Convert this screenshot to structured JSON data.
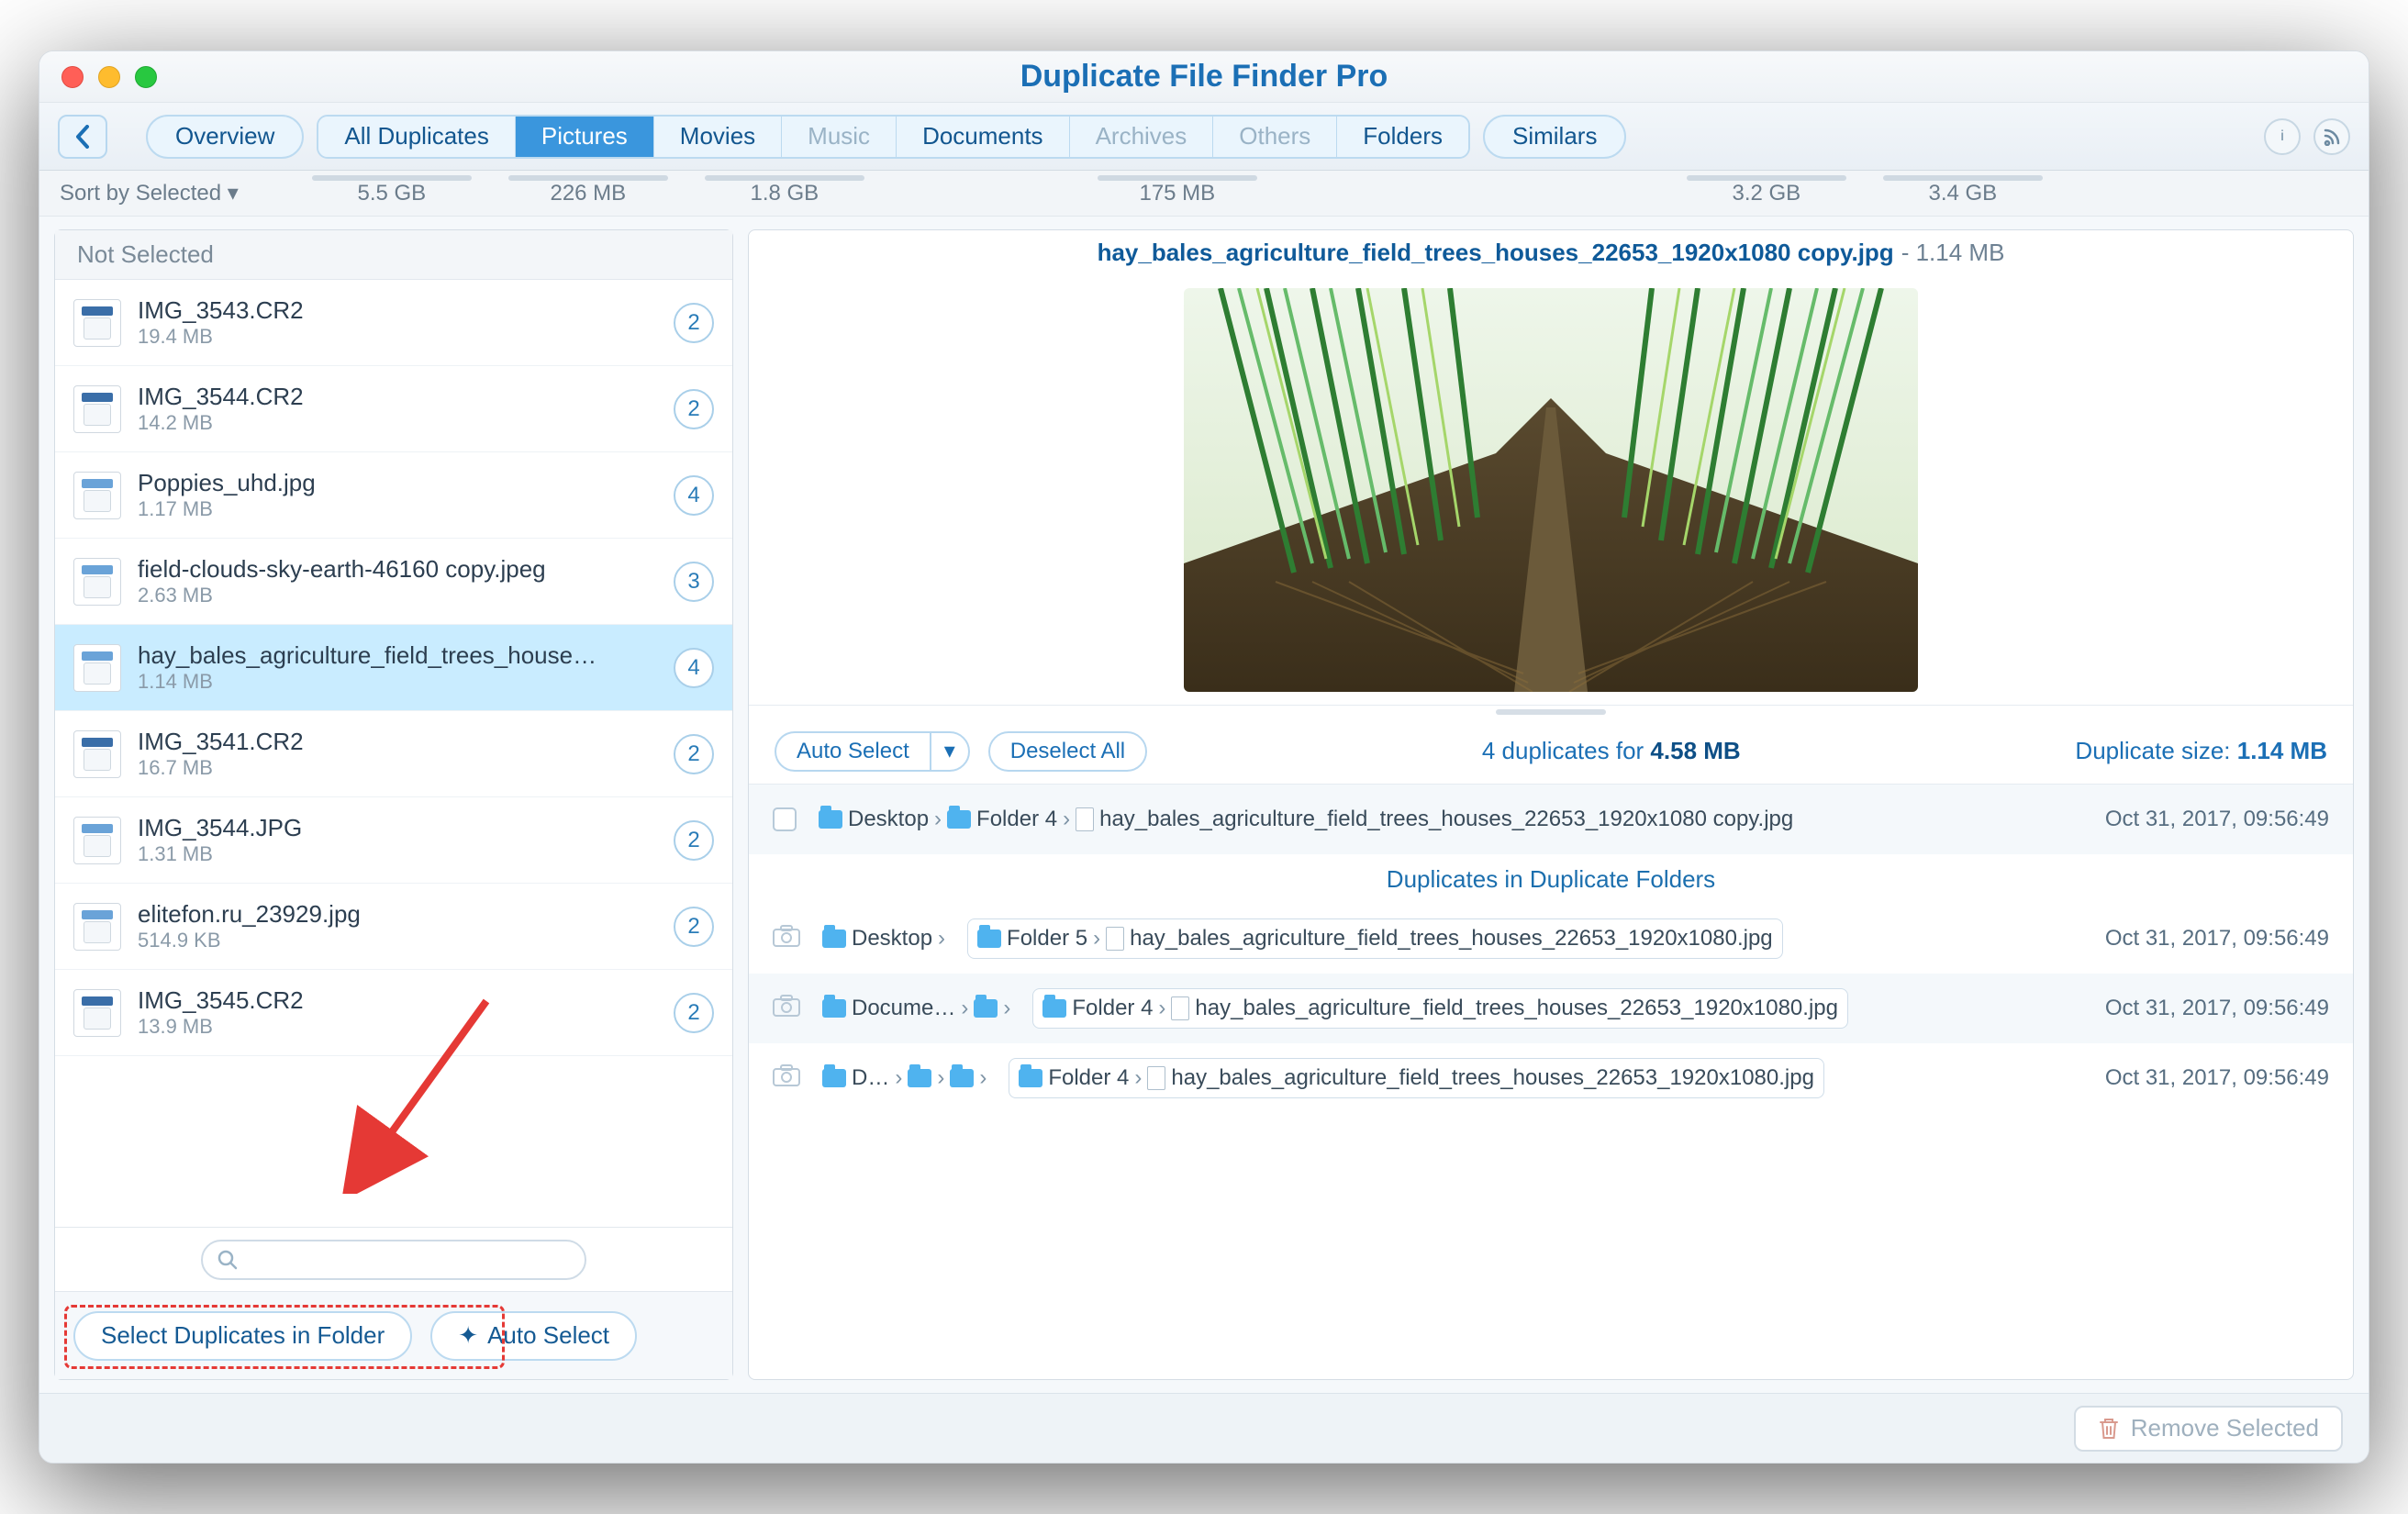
{
  "window": {
    "title": "Duplicate File Finder Pro"
  },
  "toolbar": {
    "overview": "Overview",
    "tabs": [
      {
        "label": "All Duplicates",
        "size": "5.5 GB",
        "disabled": false
      },
      {
        "label": "Pictures",
        "size": "226 MB",
        "active": true
      },
      {
        "label": "Movies",
        "size": "1.8 GB"
      },
      {
        "label": "Music",
        "size": "",
        "disabled": true
      },
      {
        "label": "Documents",
        "size": "175 MB"
      },
      {
        "label": "Archives",
        "size": "",
        "disabled": true
      },
      {
        "label": "Others",
        "size": "",
        "disabled": true
      },
      {
        "label": "Folders",
        "size": "3.2 GB"
      }
    ],
    "similars": "Similars",
    "similars_size": "3.4 GB",
    "sort": "Sort by Selected"
  },
  "left": {
    "section": "Not Selected",
    "files": [
      {
        "name": "IMG_3543.CR2",
        "size": "19.4 MB",
        "count": "2",
        "type": "cr2"
      },
      {
        "name": "IMG_3544.CR2",
        "size": "14.2 MB",
        "count": "2",
        "type": "cr2"
      },
      {
        "name": "Poppies_uhd.jpg",
        "size": "1.17 MB",
        "count": "4",
        "type": "jpg"
      },
      {
        "name": "field-clouds-sky-earth-46160 copy.jpeg",
        "size": "2.63 MB",
        "count": "3",
        "type": "jpg"
      },
      {
        "name": "hay_bales_agriculture_field_trees_house…",
        "size": "1.14 MB",
        "count": "4",
        "type": "jpg",
        "selected": true
      },
      {
        "name": "IMG_3541.CR2",
        "size": "16.7 MB",
        "count": "2",
        "type": "cr2"
      },
      {
        "name": "IMG_3544.JPG",
        "size": "1.31 MB",
        "count": "2",
        "type": "jpg"
      },
      {
        "name": "elitefon.ru_23929.jpg",
        "size": "514.9 KB",
        "count": "2",
        "type": "jpg"
      },
      {
        "name": "IMG_3545.CR2",
        "size": "13.9 MB",
        "count": "2",
        "type": "cr2"
      }
    ],
    "select_in_folder": "Select Duplicates in Folder",
    "auto_select": "Auto Select"
  },
  "preview": {
    "filename": "hay_bales_agriculture_field_trees_houses_22653_1920x1080 copy.jpg",
    "size": "1.14 MB"
  },
  "dupbar": {
    "auto_select": "Auto Select",
    "deselect": "Deselect All",
    "summary_prefix": "4 duplicates for ",
    "summary_bold": "4.58 MB",
    "right_label": "Duplicate size: ",
    "right_bold": "1.14 MB"
  },
  "duplicates": {
    "main": {
      "path": [
        "Desktop",
        "Folder 4",
        "hay_bales_agriculture_field_trees_houses_22653_1920x1080 copy.jpg"
      ],
      "date": "Oct 31, 2017, 09:56:49"
    },
    "sub_header": "Duplicates in Duplicate Folders",
    "rows": [
      {
        "pre": [
          "Desktop"
        ],
        "boxed": [
          "Folder 5",
          "hay_bales_agriculture_field_trees_houses_22653_1920x1080.jpg"
        ],
        "date": "Oct 31, 2017, 09:56:49"
      },
      {
        "pre": [
          "Docume…"
        ],
        "boxed": [
          "Folder 4",
          "hay_bales_agriculture_field_trees_houses_22653_1920x1080.jpg"
        ],
        "date": "Oct 31, 2017, 09:56:49",
        "extra": true
      },
      {
        "pre": [
          "D…"
        ],
        "boxed": [
          "Folder 4",
          "hay_bales_agriculture_field_trees_houses_22653_1920x1080.jpg"
        ],
        "date": "Oct 31, 2017, 09:56:49",
        "extra2": true
      }
    ]
  },
  "footer": {
    "remove": "Remove Selected"
  }
}
